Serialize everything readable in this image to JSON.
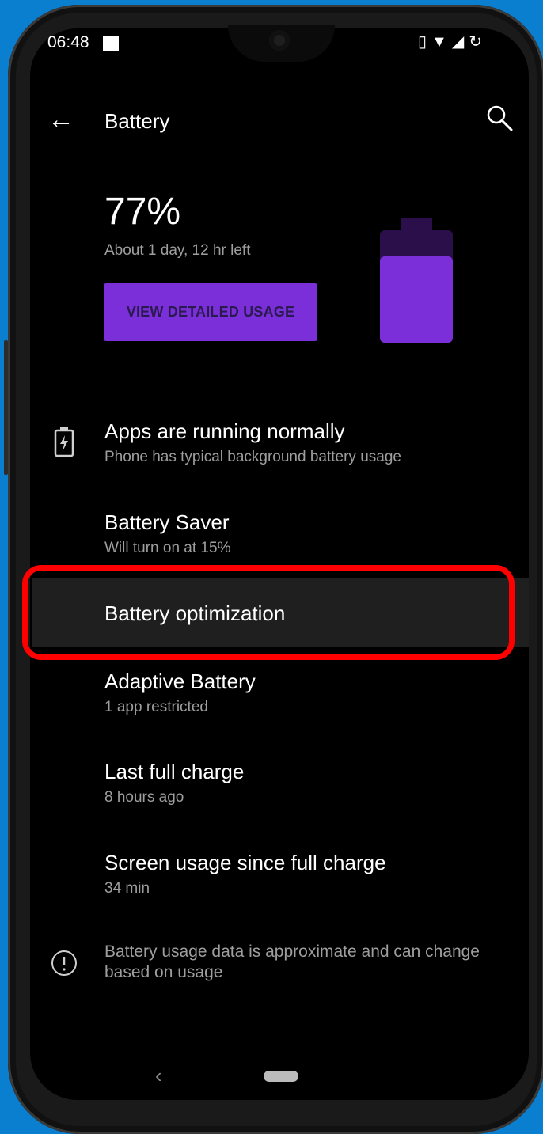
{
  "status_bar": {
    "time": "06:48",
    "icons": [
      "image-icon",
      "vibrate-icon",
      "wifi-icon",
      "signal-icon",
      "sync-icon"
    ]
  },
  "app_bar": {
    "title": "Battery",
    "back_icon": "arrow-left",
    "search_icon": "magnifier"
  },
  "summary": {
    "percent": "77%",
    "time_left": "About 1 day, 12 hr left",
    "button_label": "VIEW DETAILED USAGE",
    "battery_level": 0.77,
    "accent_color": "#7b2fd8"
  },
  "items": [
    {
      "title": "Apps are running normally",
      "subtitle": "Phone has typical background battery usage"
    },
    {
      "title": "Battery Saver",
      "subtitle": "Will turn on at 15%"
    },
    {
      "title": "Battery optimization",
      "subtitle": ""
    },
    {
      "title": "Adaptive Battery",
      "subtitle": "1 app restricted"
    },
    {
      "title": "Last full charge",
      "subtitle": "8 hours ago"
    },
    {
      "title": "Screen usage since full charge",
      "subtitle": "34 min"
    }
  ],
  "footer": {
    "note": "Battery usage data is approximate and can change based on usage"
  },
  "highlight_color": "#ff0000"
}
